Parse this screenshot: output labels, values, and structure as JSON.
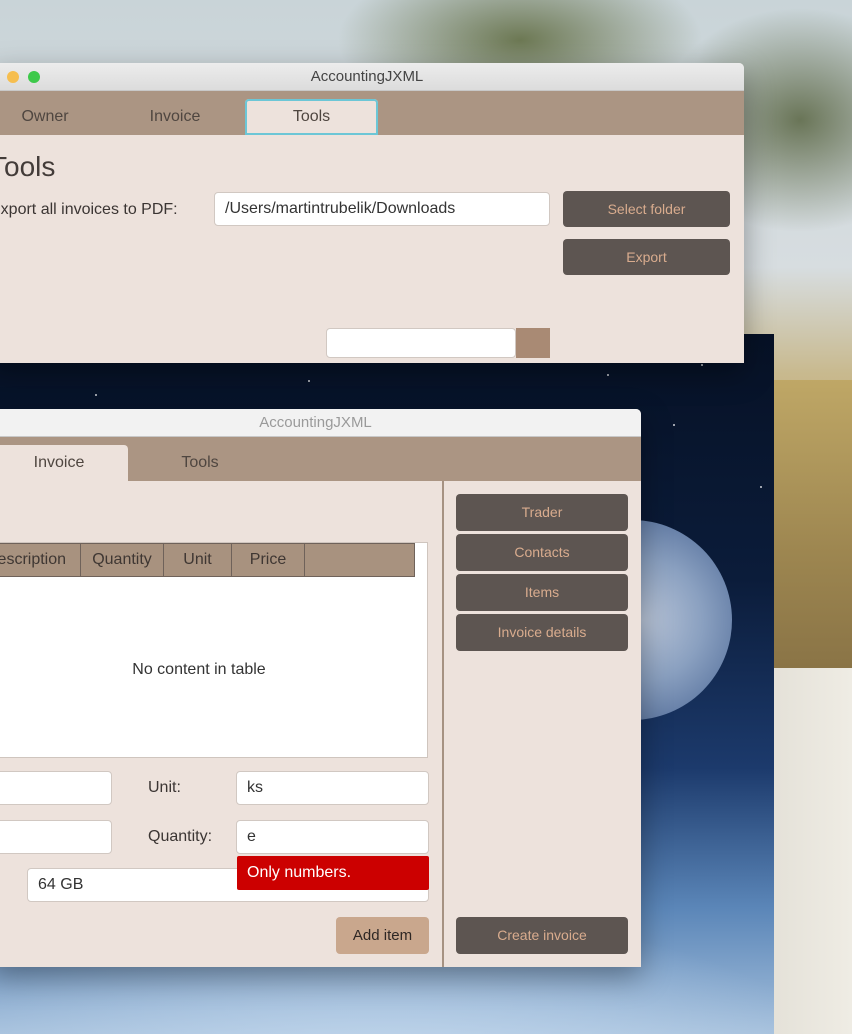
{
  "back_window": {
    "title": "AccountingJXML",
    "tabs": [
      "Owner",
      "Invoice",
      "Tools"
    ],
    "heading": "Tools",
    "export_label": "Export all invoices to PDF:",
    "path_value": "/Users/martintrubelik/Downloads",
    "select_folder": "Select folder",
    "export": "Export"
  },
  "front_window": {
    "title": "AccountingJXML",
    "tabs": [
      "Invoice",
      "Tools"
    ],
    "table": {
      "headers": [
        "Description",
        "Quantity",
        "Unit",
        "Price",
        ""
      ],
      "empty_message": "No content in table"
    },
    "form": {
      "unit_label": "Unit:",
      "unit_value": "ks",
      "quantity_label": "Quantity:",
      "quantity_value": "e",
      "size_value": "64 GB",
      "error": "Only numbers.",
      "add_item": "Add item"
    },
    "side_buttons": [
      "Trader",
      "Contacts",
      "Items",
      "Invoice details"
    ],
    "create_invoice": "Create invoice"
  },
  "colors": {
    "window_bg": "#ede2dc",
    "tab_bar": "#ab9583",
    "dark_button": "#5d5551",
    "button_text": "#d9ac8e",
    "error": "#cc0000"
  }
}
